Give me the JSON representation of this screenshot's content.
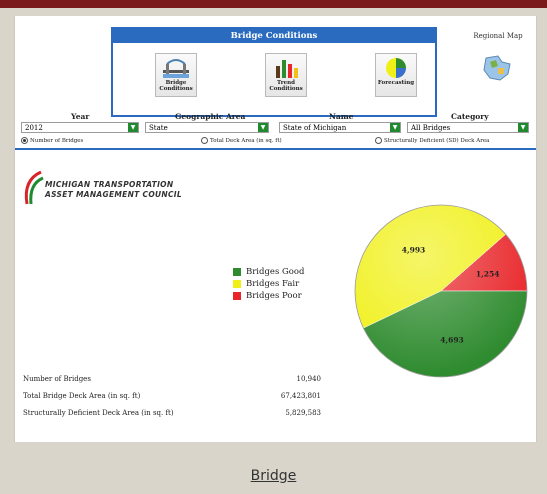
{
  "bridge_conditions": {
    "title": "Bridge Conditions",
    "buttons": [
      {
        "label1": "Bridge",
        "label2": "Conditions"
      },
      {
        "label1": "Trend",
        "label2": "Conditions"
      },
      {
        "label1": "Forecasting",
        "label2": ""
      }
    ]
  },
  "regional_map": {
    "label": "Regional Map"
  },
  "filters": {
    "year": {
      "label": "Year",
      "value": "2012"
    },
    "geographic_area": {
      "label": "Geographic Area",
      "value": "State"
    },
    "name": {
      "label": "Name",
      "value": "State of Michigan"
    },
    "category": {
      "label": "Category",
      "value": "All Bridges"
    }
  },
  "radios": [
    {
      "label": "Number of Bridges",
      "selected": true
    },
    {
      "label": "Total Deck Area (in sq. ft)",
      "selected": false
    },
    {
      "label": "Structurally Deficient (SD) Deck Area",
      "selected": false
    }
  ],
  "logo": {
    "line1": "MICHIGAN TRANSPORTATION",
    "line2": "ASSET MANAGEMENT COUNCIL"
  },
  "chart_data": {
    "type": "pie",
    "slices": [
      {
        "name": "Bridges Good",
        "value": 4693,
        "label": "4,693",
        "color": "#2e8b2e"
      },
      {
        "name": "Bridges Fair",
        "value": 4993,
        "label": "4,993",
        "color": "#f0f018"
      },
      {
        "name": "Bridges Poor",
        "value": 1254,
        "label": "1,254",
        "color": "#e8262a"
      }
    ],
    "legend": [
      "Bridges Good",
      "Bridges Fair",
      "Bridges Poor"
    ],
    "legend_position": "left"
  },
  "stats": [
    {
      "label": "Number of Bridges",
      "value": "10,940"
    },
    {
      "label": "Total Bridge Deck Area (in sq. ft)",
      "value": "67,423,801"
    },
    {
      "label": "Structurally Deficient Deck Area (in sq. ft)",
      "value": "5,829,583"
    }
  ],
  "bottom_link": "Bridge"
}
